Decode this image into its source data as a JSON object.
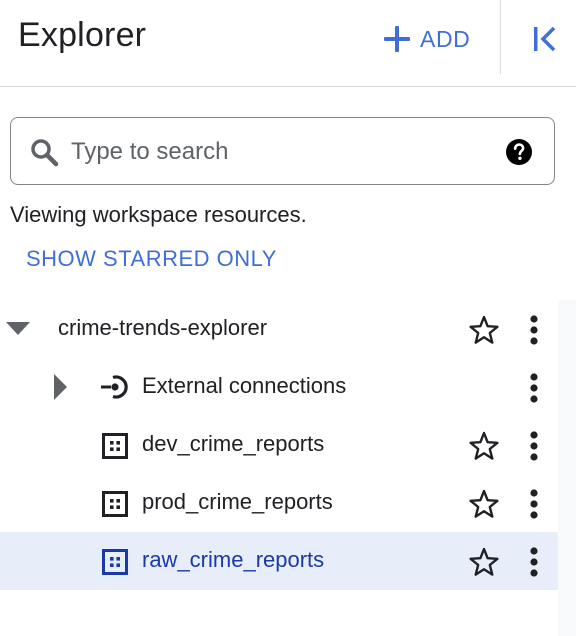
{
  "header": {
    "title": "Explorer",
    "add_label": "ADD"
  },
  "search": {
    "placeholder": "Type to search"
  },
  "info": {
    "viewing_text": "Viewing workspace resources.",
    "starred_link": "SHOW STARRED ONLY"
  },
  "tree": {
    "project": {
      "name": "crime-trends-explorer",
      "expanded": true,
      "starred": false
    },
    "children": [
      {
        "name": "External connections",
        "icon": "external-connection-icon",
        "expandable": true,
        "selected": false
      },
      {
        "name": "dev_crime_reports",
        "icon": "dataset-icon",
        "selected": false,
        "starred": false
      },
      {
        "name": "prod_crime_reports",
        "icon": "dataset-icon",
        "selected": false,
        "starred": false
      },
      {
        "name": "raw_crime_reports",
        "icon": "dataset-icon",
        "selected": true,
        "starred": false
      }
    ]
  },
  "colors": {
    "accent": "#3f6fd6",
    "selected_row_bg": "#e8eef9",
    "selected_text": "#1a3aa8",
    "text": "#202124",
    "divider": "#dadce0"
  }
}
